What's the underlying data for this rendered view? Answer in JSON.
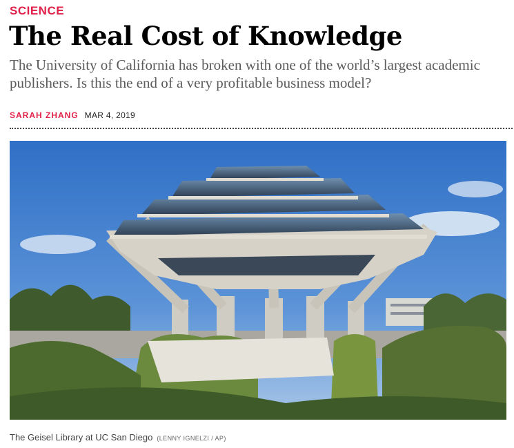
{
  "article": {
    "section": "Science",
    "headline": "The Real Cost of Knowledge",
    "dek": "The University of California has broken with one of the world’s largest academic publishers. Is this the end of a very profitable business model?",
    "author": "Sarah Zhang",
    "date": "Mar 4, 2019"
  },
  "photo": {
    "subject": "Geisel Library building with hedges and trees under a blue sky",
    "caption": "The Geisel Library at UC San Diego",
    "credit": "(Lenny Ignelzi / AP)"
  },
  "colors": {
    "accent": "#e0224a",
    "headline": "#000000",
    "dek": "#5a5a5a",
    "sky": "#3f7fd0",
    "concrete": "#c9c6be",
    "foliage": "#5d7a3a"
  }
}
